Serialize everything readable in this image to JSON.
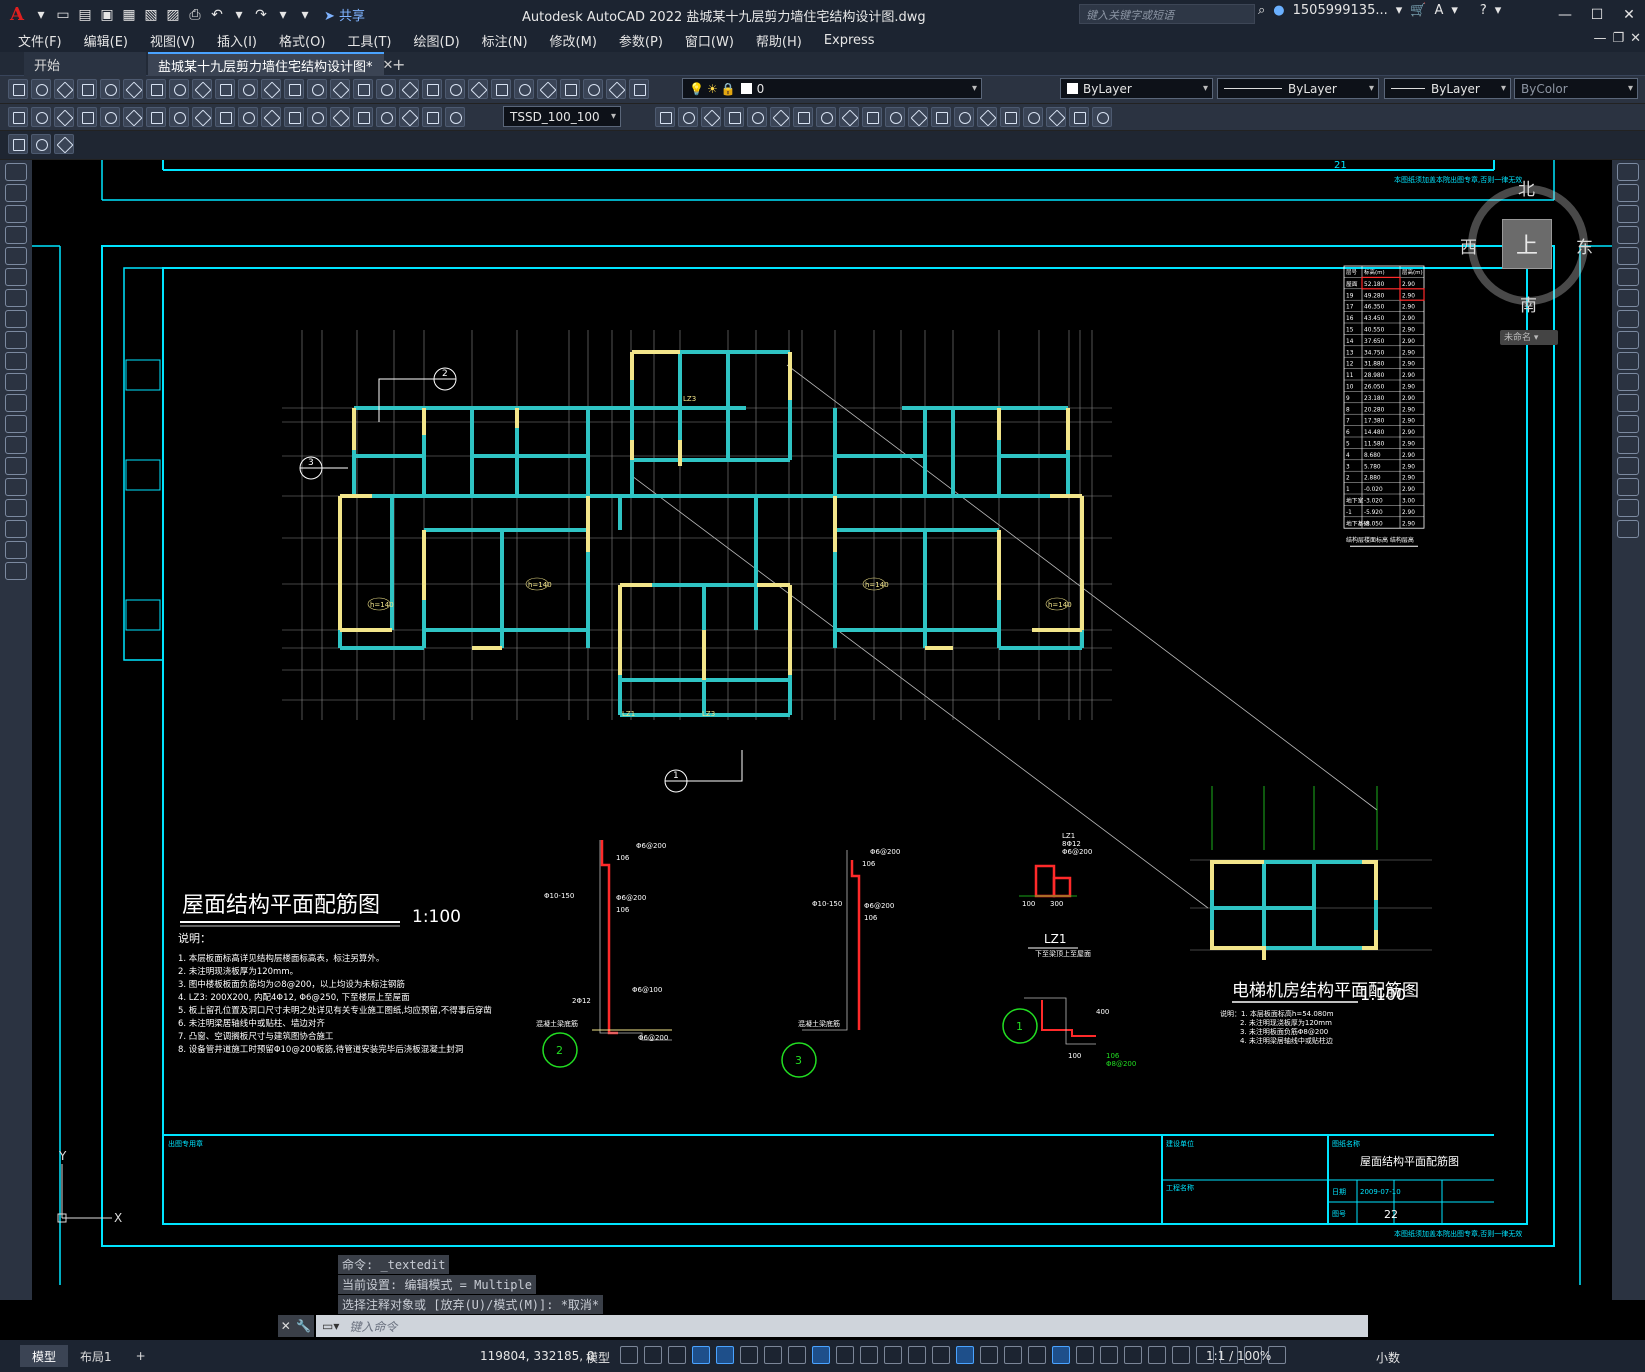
{
  "app": {
    "title": "Autodesk AutoCAD 2022    盐城某十九层剪力墙住宅结构设计图.dwg",
    "share_label": "共享",
    "search_placeholder": "键入关键字或短语",
    "user": "1505999135...",
    "logo": "A"
  },
  "menu": {
    "items": [
      "文件(F)",
      "编辑(E)",
      "视图(V)",
      "插入(I)",
      "格式(O)",
      "工具(T)",
      "绘图(D)",
      "标注(N)",
      "修改(M)",
      "参数(P)",
      "窗口(W)",
      "帮助(H)",
      "Express"
    ]
  },
  "tabs": {
    "start": "开始",
    "active": "盐城某十九层剪力墙住宅结构设计图*"
  },
  "toolbar": {
    "layer": "0",
    "color": "ByLayer",
    "linetype": "ByLayer",
    "lineweight": "ByLayer",
    "plotstyle": "ByColor",
    "dimstyle": "TSSD_100_100"
  },
  "viewcube": {
    "north": "北",
    "south": "南",
    "west": "西",
    "east": "东",
    "top": "上",
    "wcs": "未命名"
  },
  "drawing": {
    "main_title": "屋面结构平面配筋图",
    "main_scale": "1:100",
    "notes_title": "说明：",
    "notes": [
      "1. 本层板面标高详见结构层楼面标高表，标注另算外。",
      "2. 未注明现浇板厚为120mm。",
      "3. 图中楼板板面负筋均为∅8@200，以上均设为未标注钢筋",
      "4. LZ3: 200X200, 内配4Φ12, Φ6@250, 下至楼层上至屋面",
      "5. 板上留孔位置及洞口尺寸未明之处详见有关专业施工图纸,均应预留,不得事后穿凿",
      "6. 未注明梁居轴线中或贴柱、墙边对齐",
      "7. 凸窗、空调搁板尺寸与建筑图协合施工",
      "8. 设备管井道施工时预留Φ10@200板筋,待管道安装完毕后浇板混凝土封洞"
    ],
    "elevator_title": "电梯机房结构平面配筋图",
    "elevator_scale": "1:100",
    "elevator_notes": [
      "说明：1. 本层板面标高h=54.080m",
      "2. 未注明现浇板厚为120mm",
      "3. 未注明板面负筋Φ8@200",
      "4. 未注明梁居轴线中或贴柱边"
    ],
    "section_labels": {
      "s1": "1",
      "s2": "2",
      "s3": "3",
      "d1": "Φ6@200",
      "d2": "Φ10-150",
      "d3": "Φ6@100",
      "d4": "Φ8@200",
      "d5": "2Φ12",
      "d6": "106",
      "d7": "LZ1",
      "d8": "下至梁顶上至屋面",
      "d9": "8Φ12",
      "d10": "300",
      "d11": "100",
      "d12": "400",
      "d13": "混凝土梁底筋"
    },
    "title_block": {
      "drawing_name": "屋面结构平面配筋图",
      "sheet_no": "22",
      "top_sheet_no": "21",
      "label_company": "建设单位",
      "label_project": "工程名称",
      "label_chief": "出图专用章",
      "label_drawing": "图纸名称",
      "label_number": "图号",
      "label_date": "日期",
      "date_value": "2009-07-10",
      "note_footer": "本图纸须加盖本院出图专章,否则一律无效"
    },
    "elev_table_header": [
      "层号",
      "标高(m)",
      "层高(m)"
    ],
    "elev_table": [
      [
        "屋面",
        "52.180",
        "2.90"
      ],
      [
        "19",
        "49.280",
        "2.90"
      ],
      [
        "17",
        "46.350",
        "2.90"
      ],
      [
        "16",
        "43.450",
        "2.90"
      ],
      [
        "15",
        "40.550",
        "2.90"
      ],
      [
        "14",
        "37.650",
        "2.90"
      ],
      [
        "13",
        "34.750",
        "2.90"
      ],
      [
        "12",
        "31.880",
        "2.90"
      ],
      [
        "11",
        "28.980",
        "2.90"
      ],
      [
        "10",
        "26.050",
        "2.90"
      ],
      [
        "9",
        "23.180",
        "2.90"
      ],
      [
        "8",
        "20.280",
        "2.90"
      ],
      [
        "7",
        "17.380",
        "2.90"
      ],
      [
        "6",
        "14.480",
        "2.90"
      ],
      [
        "5",
        "11.580",
        "2.90"
      ],
      [
        "4",
        "8.680",
        "2.90"
      ],
      [
        "3",
        "5.780",
        "2.90"
      ],
      [
        "2",
        "2.880",
        "2.90"
      ],
      [
        "1",
        "-0.020",
        "2.90"
      ],
      [
        "地下室",
        "-3.020",
        "3.00"
      ],
      [
        "-1",
        "-5.920",
        "2.90"
      ],
      [
        "地下基础",
        "-8.050",
        "2.90"
      ]
    ],
    "elev_table_caption": "结构层楼面标高 结构层高",
    "room_labels": [
      "h=140",
      "h=140",
      "h=140",
      "h=140",
      "LZ3",
      "LZ3",
      "LZ1"
    ]
  },
  "command": {
    "line1": "命令: _textedit",
    "line2": "当前设置: 编辑模式 = Multiple",
    "line3": "选择注释对象或 [放弃(U)/模式(M)]: *取消*",
    "placeholder": "键入命令"
  },
  "status": {
    "model_tab": "模型",
    "layout_tab": "布局1",
    "coords": "119804, 332185, 0",
    "model": "模型",
    "scale": "1:1 / 100%",
    "units": "小数"
  },
  "colors": {
    "cyan": "#00e5ff",
    "teal_wall": "#2fc4c4",
    "yellow_wall": "#f2e58a",
    "red_column": "#ff2a2a",
    "green": "#22dd22"
  }
}
